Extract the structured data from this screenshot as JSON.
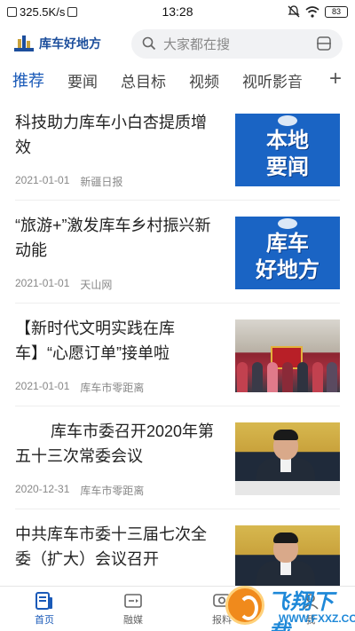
{
  "status_bar": {
    "network_speed": "325.5K/s",
    "time": "13:28",
    "battery": "83"
  },
  "header": {
    "app_name": "库车好地方",
    "search_placeholder": "大家都在搜"
  },
  "tabs": [
    {
      "label": "推荐",
      "active": true
    },
    {
      "label": "要闻",
      "active": false
    },
    {
      "label": "总目标",
      "active": false
    },
    {
      "label": "视频",
      "active": false
    },
    {
      "label": "视听影音",
      "active": false
    }
  ],
  "tabs_add_icon": "+",
  "news": [
    {
      "title": "科技助力库车小白杏提质增效",
      "date": "2021-01-01",
      "source": "新疆日报",
      "thumb_text": "本地\n要闻",
      "thumb_kind": "blue-title"
    },
    {
      "title": "“旅游+”激发库车乡村振兴新动能",
      "date": "2021-01-01",
      "source": "天山网",
      "thumb_text": "库车\n好地方",
      "thumb_kind": "blue-title"
    },
    {
      "title": "【新时代文明实践在库车】“心愿订单”接单啦",
      "date": "2021-01-01",
      "source": "库车市零距离",
      "thumb_kind": "group-photo"
    },
    {
      "title": "        库车市委召开2020年第五十三次常委会议",
      "date": "2020-12-31",
      "source": "库车市零距离",
      "thumb_kind": "meeting-photo"
    },
    {
      "title": "中共库车市委十三届七次全委（扩大）会议召开",
      "date": "",
      "source": "",
      "thumb_kind": "meeting-photo"
    }
  ],
  "bottom_nav": [
    {
      "label": "首页",
      "icon": "home-news-icon",
      "active": true
    },
    {
      "label": "融媒",
      "icon": "media-icon",
      "active": false
    },
    {
      "label": "报料",
      "icon": "report-icon",
      "active": false
    },
    {
      "label": "我",
      "icon": "profile-icon",
      "active": false
    }
  ],
  "watermark": {
    "brand": "飞翔下载",
    "url": "WWW.FXXZ.COM"
  },
  "colors": {
    "accent": "#1a5ab8",
    "logo_blue": "#1c4e9c",
    "thumb_blue": "#1a64c4",
    "watermark_orange": "#f08a1c"
  }
}
